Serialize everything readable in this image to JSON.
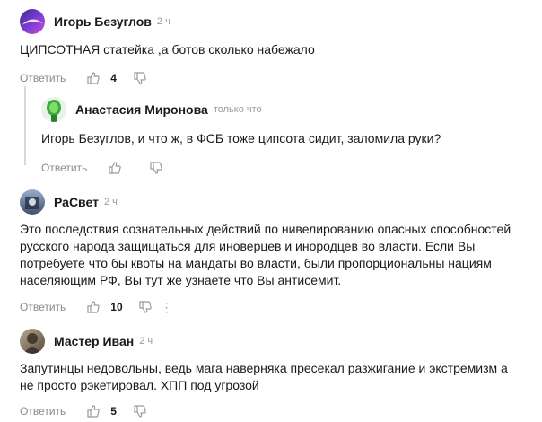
{
  "comments": [
    {
      "author": "Игорь Безуглов",
      "time": "2 ч",
      "text": "ЦИПСОТНАЯ статейка ,а ботов сколько набежало",
      "reply_label": "Ответить",
      "likes": "4",
      "avatar_colors": [
        "#3b2b8f",
        "#c54fd9"
      ]
    },
    {
      "author": "Анастасия Миронова",
      "time": "только что",
      "text": "Игорь Безуглов, и что ж, в ФСБ тоже ципсота сидит, заломила руки?",
      "reply_label": "Ответить",
      "likes": "",
      "avatar_colors": [
        "#2f7d2f",
        "#5fd35f"
      ]
    },
    {
      "author": "РаСвет",
      "time": "2 ч",
      "text_lines": [
        "Это последствия сознательных действий по нивелированию опасных способностей",
        "русского народа защищаться для иноверцев и инородцев во власти. Если Вы",
        "потребуете что бы квоты на мандаты во власти, были пропорциональны нациям",
        "населяющим РФ, Вы тут же узнаете что Вы антисемит."
      ],
      "reply_label": "Ответить",
      "likes": "10",
      "more": "⋮",
      "avatar_colors": [
        "#3d4f6e",
        "#9bb0c8"
      ]
    },
    {
      "author": "Мастер Иван",
      "time": "2 ч",
      "text_lines": [
        "Запутинцы недовольны, ведь мага наверняка пресекал разжигание и экстремизм а",
        "не просто рэкетировал. ХПП под угрозой"
      ],
      "reply_label": "Ответить",
      "likes": "5",
      "avatar_colors": [
        "#5a4a3a",
        "#b8a890"
      ]
    }
  ]
}
